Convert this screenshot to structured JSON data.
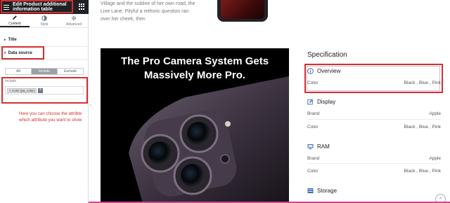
{
  "panel": {
    "title": "Edit Product additional information table",
    "tabs": [
      {
        "label": "Content",
        "icon": "pencil-icon"
      },
      {
        "label": "Style",
        "icon": "contrast-icon"
      },
      {
        "label": "Advanced",
        "icon": "gear-icon"
      }
    ],
    "sections": {
      "title_label": "Title",
      "data_source_label": "Data source"
    },
    "segment": [
      "All",
      "Include",
      "Exclude"
    ],
    "include_label": "Include",
    "chip_label": "× Color (pa_color)",
    "chip_add": "+",
    "note": "Here you can choose the attribte which attribute you want to show"
  },
  "preview": {
    "intro": "Village and the subline of her own road, the Line Lane. Pityful a rethoric question ran over her cheek, then",
    "hero_title": "The Pro Camera System Gets Massively More Pro.",
    "spec_heading": "Specification",
    "sections": [
      {
        "name": "Overview",
        "icon": "info-icon",
        "rows": [
          {
            "label": "Color",
            "value": "Black , Blue , Pink"
          }
        ]
      },
      {
        "name": "Display",
        "icon": "edit-icon",
        "rows": [
          {
            "label": "Brand",
            "value": "Apple"
          },
          {
            "label": "Color",
            "value": "Black , Blue , Pink"
          }
        ]
      },
      {
        "name": "RAM",
        "icon": "monitor-icon",
        "rows": [
          {
            "label": "Brand",
            "value": "Apple"
          },
          {
            "label": "Color",
            "value": "Black , Blue , Pink"
          }
        ]
      },
      {
        "name": "Storage",
        "icon": "storage-icon",
        "rows": []
      }
    ],
    "scroll_top": "^"
  },
  "colors": {
    "annotation": "#d32f2f",
    "panel_header": "#1f2124",
    "icon_blue": "#3b6fb6"
  }
}
